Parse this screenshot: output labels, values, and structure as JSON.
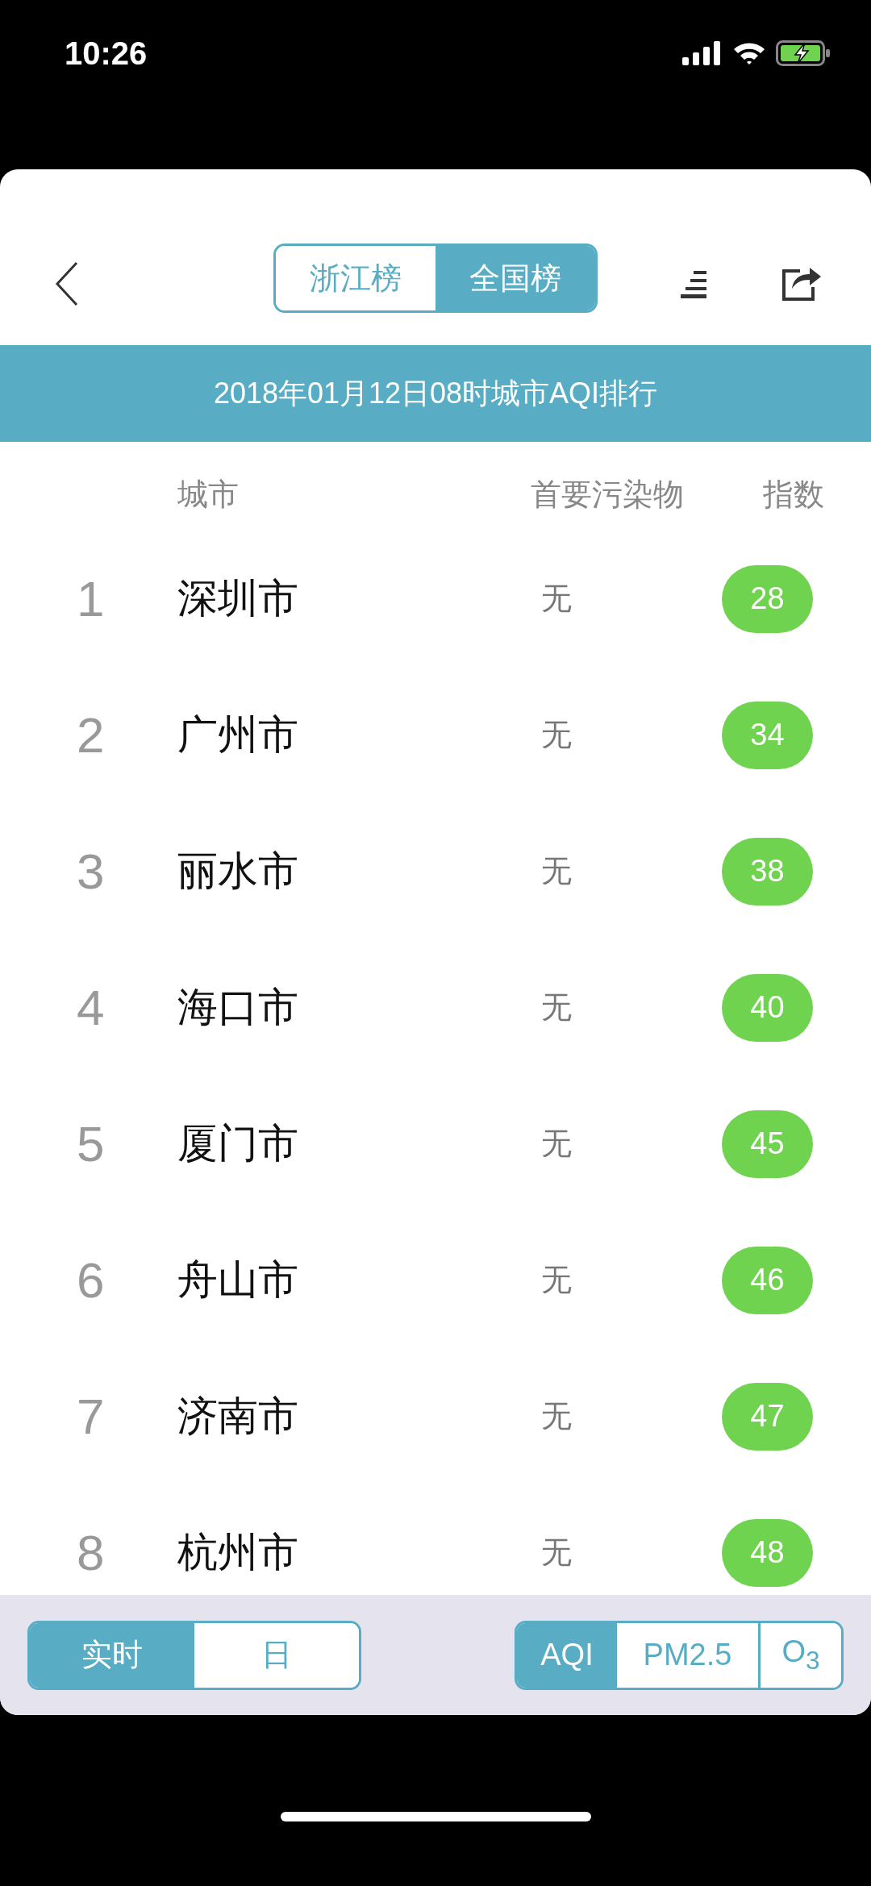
{
  "status_bar": {
    "time": "10:26"
  },
  "header": {
    "tabs": [
      {
        "label": "浙江榜",
        "selected": false
      },
      {
        "label": "全国榜",
        "selected": true
      }
    ]
  },
  "banner": {
    "title": "2018年01月12日08时城市AQI排行"
  },
  "table": {
    "columns": [
      "城市",
      "首要污染物",
      "指数"
    ],
    "rows": [
      {
        "rank": "1",
        "city": "深圳市",
        "pollutant": "无",
        "index": "28"
      },
      {
        "rank": "2",
        "city": "广州市",
        "pollutant": "无",
        "index": "34"
      },
      {
        "rank": "3",
        "city": "丽水市",
        "pollutant": "无",
        "index": "38"
      },
      {
        "rank": "4",
        "city": "海口市",
        "pollutant": "无",
        "index": "40"
      },
      {
        "rank": "5",
        "city": "厦门市",
        "pollutant": "无",
        "index": "45"
      },
      {
        "rank": "6",
        "city": "舟山市",
        "pollutant": "无",
        "index": "46"
      },
      {
        "rank": "7",
        "city": "济南市",
        "pollutant": "无",
        "index": "47"
      },
      {
        "rank": "8",
        "city": "杭州市",
        "pollutant": "无",
        "index": "48"
      }
    ]
  },
  "bottom_bar": {
    "periods": [
      {
        "label": "实时",
        "selected": true
      },
      {
        "label": "日",
        "selected": false
      }
    ],
    "metrics": [
      {
        "label": "AQI",
        "selected": true
      },
      {
        "label": "PM2.5",
        "selected": false
      },
      {
        "label": "O$_{3}$",
        "selected": false
      }
    ]
  }
}
